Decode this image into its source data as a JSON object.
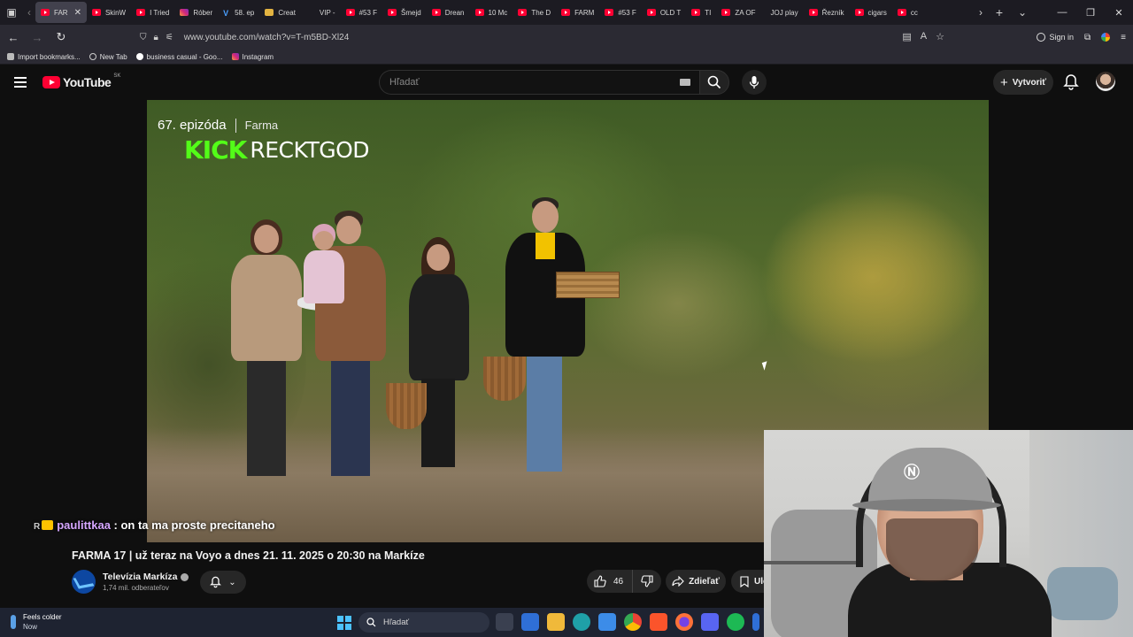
{
  "browser": {
    "tabs": [
      {
        "label": "FAR",
        "active": true,
        "icon": "youtube-icon"
      },
      {
        "label": "SkinW",
        "icon": "youtube-icon"
      },
      {
        "label": "I Tried",
        "icon": "youtube-icon"
      },
      {
        "label": "Róber",
        "icon": "instagram-icon"
      },
      {
        "label": "58. ep",
        "icon": "v-icon"
      },
      {
        "label": "Creat",
        "icon": "doc-icon"
      },
      {
        "label": "VIP -",
        "icon": "kick-icon"
      },
      {
        "label": "#53 F",
        "icon": "youtube-icon"
      },
      {
        "label": "Šmejd",
        "icon": "youtube-icon"
      },
      {
        "label": "Drean",
        "icon": "youtube-icon"
      },
      {
        "label": "10 Mc",
        "icon": "youtube-icon"
      },
      {
        "label": "The D",
        "icon": "youtube-icon"
      },
      {
        "label": "FARM",
        "icon": "youtube-icon"
      },
      {
        "label": "#53 F",
        "icon": "youtube-icon"
      },
      {
        "label": "OLD T",
        "icon": "youtube-icon"
      },
      {
        "label": "TI",
        "icon": "youtube-icon"
      },
      {
        "label": "ZA OF",
        "icon": "youtube-icon"
      },
      {
        "label": "JOJ play",
        "icon": "none"
      },
      {
        "label": "Řezník",
        "icon": "youtube-icon"
      },
      {
        "label": "cigars",
        "icon": "youtube-icon"
      },
      {
        "label": "cc",
        "icon": "youtube-icon"
      }
    ],
    "url": "www.youtube.com/watch?v=T-m5BD-Xl24",
    "sign_in": "Sign in",
    "bookmarks": [
      {
        "label": "Import bookmarks...",
        "icon": "import-icon"
      },
      {
        "label": "New Tab",
        "icon": "globe-icon"
      },
      {
        "label": "business casual - Goo...",
        "icon": "google-icon"
      },
      {
        "label": "Instagram",
        "icon": "instagram-icon"
      }
    ]
  },
  "youtube": {
    "logo_text": "YouTube",
    "country_code": "SK",
    "search_placeholder": "Hľadať",
    "create_label": "Vytvoriť"
  },
  "video": {
    "episode": "67. epizóda",
    "show": "Farma",
    "kick_logo": "KICK",
    "kick_channel": "RECKTGOD",
    "title": "FARMA 17 | už teraz na Voyo a dnes 21. 11. 2025 o 20:30 na Markíze",
    "channel_name": "Televízia Markíza",
    "subscribers": "1,74 mil. odberateľov",
    "likes": "46",
    "share_label": "Zdieľať",
    "save_label": "Ulo"
  },
  "chat": {
    "username": "paulittkaa",
    "message": ": on ta ma proste precitaneho"
  },
  "taskbar": {
    "weather_title": "Feels colder",
    "weather_sub": "Now",
    "search_placeholder": "Hľadať"
  }
}
